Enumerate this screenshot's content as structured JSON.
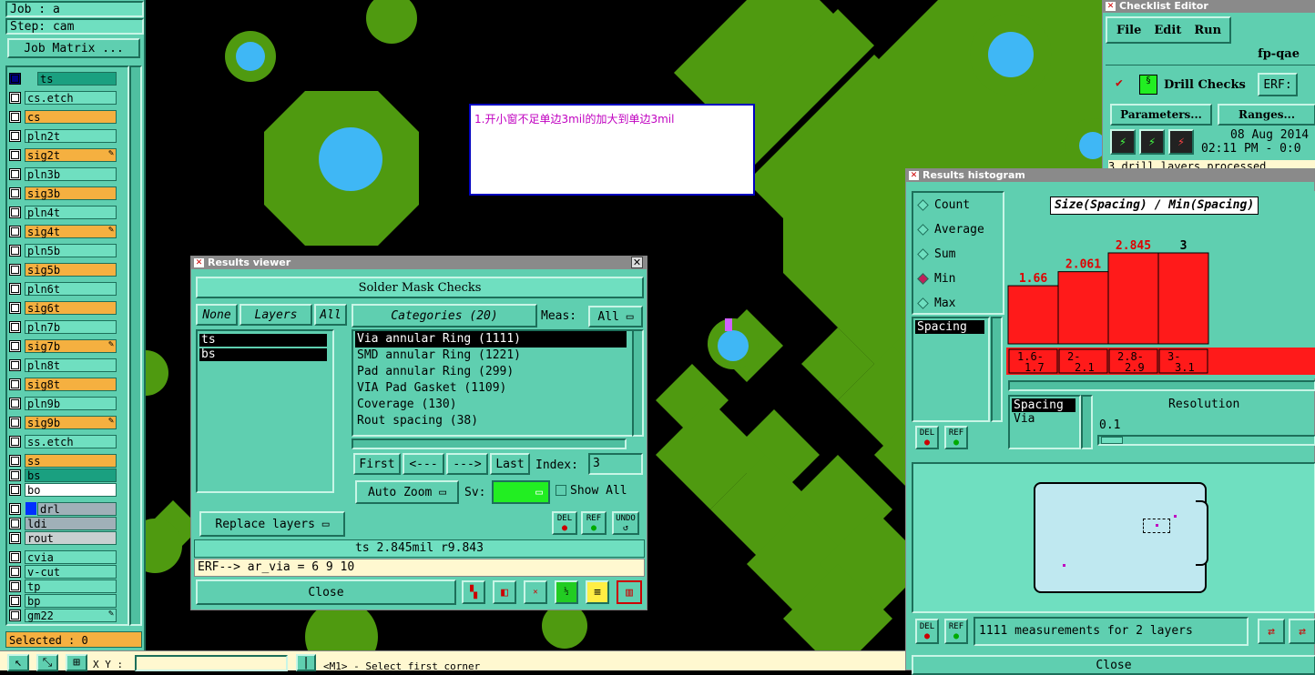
{
  "left": {
    "job": "Job : a",
    "step": "Step: cam",
    "job_matrix": "Job Matrix ...",
    "selected": "Selected : 0",
    "layers": [
      {
        "name": "ts",
        "color": "#1aa080",
        "mark": ""
      },
      {
        "name": "cs.etch",
        "color": "#6fdfc0",
        "mark": ""
      },
      {
        "name": "cs",
        "color": "#f5b040",
        "mark": ""
      },
      {
        "name": "pln2t",
        "color": "#6fdfc0",
        "mark": ""
      },
      {
        "name": "sig2t",
        "color": "#f5b040",
        "mark": "✎"
      },
      {
        "name": "pln3b",
        "color": "#6fdfc0",
        "mark": ""
      },
      {
        "name": "sig3b",
        "color": "#f5b040",
        "mark": ""
      },
      {
        "name": "pln4t",
        "color": "#6fdfc0",
        "mark": ""
      },
      {
        "name": "sig4t",
        "color": "#f5b040",
        "mark": "✎"
      },
      {
        "name": "pln5b",
        "color": "#6fdfc0",
        "mark": ""
      },
      {
        "name": "sig5b",
        "color": "#f5b040",
        "mark": ""
      },
      {
        "name": "pln6t",
        "color": "#6fdfc0",
        "mark": ""
      },
      {
        "name": "sig6t",
        "color": "#f5b040",
        "mark": ""
      },
      {
        "name": "pln7b",
        "color": "#6fdfc0",
        "mark": ""
      },
      {
        "name": "sig7b",
        "color": "#f5b040",
        "mark": "✎"
      },
      {
        "name": "pln8t",
        "color": "#6fdfc0",
        "mark": ""
      },
      {
        "name": "sig8t",
        "color": "#f5b040",
        "mark": ""
      },
      {
        "name": "pln9b",
        "color": "#6fdfc0",
        "mark": ""
      },
      {
        "name": "sig9b",
        "color": "#f5b040",
        "mark": "✎"
      },
      {
        "name": "ss.etch",
        "color": "#6fdfc0",
        "mark": ""
      },
      {
        "name": "ss",
        "color": "#f5b040",
        "mark": ""
      },
      {
        "name": "bs",
        "color": "#1aa080",
        "mark": ""
      },
      {
        "name": "bo",
        "color": "#ffffff",
        "mark": ""
      },
      {
        "name": "drl",
        "color": "#a0b0b8",
        "mark": ""
      },
      {
        "name": "ldi",
        "color": "#a0b0b8",
        "mark": ""
      },
      {
        "name": "rout",
        "color": "#c8d0d0",
        "mark": ""
      },
      {
        "name": "cvia",
        "color": "#6fdfc0",
        "mark": ""
      },
      {
        "name": "v-cut",
        "color": "#6fdfc0",
        "mark": ""
      },
      {
        "name": "tp",
        "color": "#6fdfc0",
        "mark": ""
      },
      {
        "name": "bp",
        "color": "#6fdfc0",
        "mark": ""
      },
      {
        "name": "gm22",
        "color": "#6fdfc0",
        "mark": "✎"
      }
    ]
  },
  "note": "1.开小窗不足单边3mil的加大到单边3mil",
  "status": {
    "xy_label": "X Y :",
    "prompt": "<M1> - Select first corner"
  },
  "results_viewer": {
    "title": "Results viewer",
    "header": "Solder Mask Checks",
    "none": "None",
    "layers": "Layers",
    "all": "All",
    "categories": "Categories (20)",
    "meas_label": "Meas:",
    "meas_value": "All",
    "layer_list": [
      "ts",
      "bs"
    ],
    "category_list": [
      "Via annular Ring (1111)",
      "SMD annular Ring (1221)",
      "Pad annular Ring (299)",
      "VIA Pad Gasket (1109)",
      "Coverage (130)",
      "Rout spacing (38)"
    ],
    "first": "First",
    "prev": "<---",
    "next": "--->",
    "last": "Last",
    "index_label": "Index:",
    "index_value": "3",
    "auto_zoom": "Auto Zoom",
    "sv_label": "Sv:",
    "show_all": "Show All",
    "replace_layers": "Replace layers",
    "del": "DEL",
    "ref": "REF",
    "undo": "UNDO",
    "measurement": "ts 2.845mil   r9.843",
    "erf": "ERF--> ar_via = 6 9 10",
    "close": "Close"
  },
  "checklist": {
    "title": "Checklist Editor",
    "menu": [
      "File",
      "Edit",
      "Run"
    ],
    "name": "fp-qae",
    "drill_checks": "Drill Checks",
    "erf": "ERF:",
    "parameters": "Parameters...",
    "ranges": "Ranges...",
    "date": "08 Aug 2014",
    "time": "02:11 PM - 0:0",
    "log": "3 drill layers processed"
  },
  "histogram": {
    "title": "Results histogram",
    "options": [
      "Count",
      "Average",
      "Sum",
      "Min",
      "Max"
    ],
    "selected_option": "Min",
    "chart_title": "Size(Spacing) / Min(Spacing)",
    "list1": [
      "Spacing"
    ],
    "list2": [
      "Spacing",
      "Via"
    ],
    "resolution_label": "Resolution",
    "resolution_value": "0.1",
    "del": "DEL",
    "ref": "REF",
    "summary": "1111 measurements for 2 layers",
    "close": "Close"
  },
  "chart_data": {
    "type": "bar",
    "title": "Size(Spacing) / Min(Spacing)",
    "categories": [
      "1.6-\n1.7",
      "2-\n2.1",
      "2.8-\n2.9",
      "3-\n3.1"
    ],
    "values": [
      1.66,
      2.061,
      2.845,
      3
    ],
    "value_labels": [
      "1.66",
      "2.061",
      "2.845",
      "3"
    ],
    "ylim": [
      0,
      3.2
    ],
    "bar_color": "#ff1a1a"
  }
}
